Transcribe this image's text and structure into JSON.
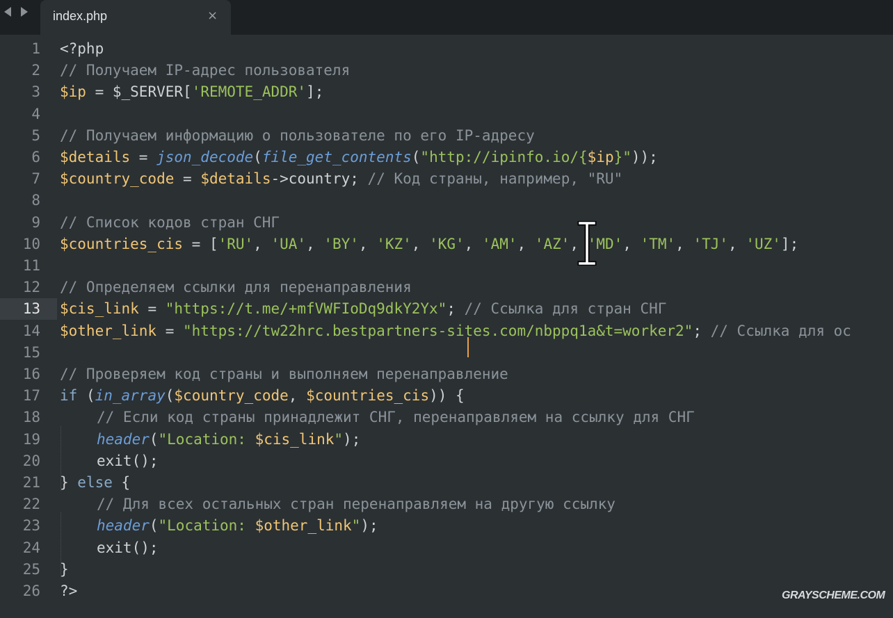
{
  "tab": {
    "title": "index.php",
    "close_glyph": "×"
  },
  "editor": {
    "active_line": 13,
    "caret_color": "#e8a04a"
  },
  "watermark": "GRAYSCHEME.COM",
  "lines": [
    {
      "num": "1",
      "tokens": [
        {
          "t": "p",
          "v": "<?php"
        }
      ]
    },
    {
      "num": "2",
      "tokens": [
        {
          "t": "c",
          "v": "// Получаем IP-адрес пользователя"
        }
      ]
    },
    {
      "num": "3",
      "tokens": [
        {
          "t": "v",
          "v": "$ip"
        },
        {
          "t": "p",
          "v": " = "
        },
        {
          "t": "sv",
          "v": "$_SERVER"
        },
        {
          "t": "p",
          "v": "["
        },
        {
          "t": "s",
          "v": "'REMOTE_ADDR'"
        },
        {
          "t": "p",
          "v": "];"
        }
      ]
    },
    {
      "num": "4",
      "tokens": []
    },
    {
      "num": "5",
      "tokens": [
        {
          "t": "c",
          "v": "// Получаем информацию о пользователе по его IP-адресу"
        }
      ]
    },
    {
      "num": "6",
      "tokens": [
        {
          "t": "v",
          "v": "$details"
        },
        {
          "t": "p",
          "v": " = "
        },
        {
          "t": "f",
          "v": "json_decode"
        },
        {
          "t": "p",
          "v": "("
        },
        {
          "t": "f",
          "v": "file_get_contents"
        },
        {
          "t": "p",
          "v": "("
        },
        {
          "t": "s",
          "v": "\"http://ipinfo.io/"
        },
        {
          "t": "s",
          "v": "{"
        },
        {
          "t": "v",
          "v": "$ip"
        },
        {
          "t": "s",
          "v": "}\""
        },
        {
          "t": "p",
          "v": "));"
        }
      ]
    },
    {
      "num": "7",
      "tokens": [
        {
          "t": "v",
          "v": "$country_code"
        },
        {
          "t": "p",
          "v": " = "
        },
        {
          "t": "v",
          "v": "$details"
        },
        {
          "t": "p",
          "v": "->country; "
        },
        {
          "t": "c",
          "v": "// Код страны, например, \"RU\""
        }
      ]
    },
    {
      "num": "8",
      "tokens": []
    },
    {
      "num": "9",
      "tokens": [
        {
          "t": "c",
          "v": "// Список кодов стран СНГ"
        }
      ]
    },
    {
      "num": "10",
      "tokens": [
        {
          "t": "v",
          "v": "$countries_cis"
        },
        {
          "t": "p",
          "v": " = ["
        },
        {
          "t": "s",
          "v": "'RU'"
        },
        {
          "t": "p",
          "v": ", "
        },
        {
          "t": "s",
          "v": "'UA'"
        },
        {
          "t": "p",
          "v": ", "
        },
        {
          "t": "s",
          "v": "'BY'"
        },
        {
          "t": "p",
          "v": ", "
        },
        {
          "t": "s",
          "v": "'KZ'"
        },
        {
          "t": "p",
          "v": ", "
        },
        {
          "t": "s",
          "v": "'KG'"
        },
        {
          "t": "p",
          "v": ", "
        },
        {
          "t": "s",
          "v": "'AM'"
        },
        {
          "t": "p",
          "v": ", "
        },
        {
          "t": "s",
          "v": "'AZ'"
        },
        {
          "t": "p",
          "v": ", "
        },
        {
          "t": "s",
          "v": "'MD'"
        },
        {
          "t": "p",
          "v": ", "
        },
        {
          "t": "s",
          "v": "'TM'"
        },
        {
          "t": "p",
          "v": ", "
        },
        {
          "t": "s",
          "v": "'TJ'"
        },
        {
          "t": "p",
          "v": ", "
        },
        {
          "t": "s",
          "v": "'UZ'"
        },
        {
          "t": "p",
          "v": "];"
        }
      ]
    },
    {
      "num": "11",
      "tokens": []
    },
    {
      "num": "12",
      "tokens": [
        {
          "t": "c",
          "v": "// Определяем ссылки для перенаправления"
        }
      ]
    },
    {
      "num": "13",
      "tokens": [
        {
          "t": "v",
          "v": "$cis_link"
        },
        {
          "t": "p",
          "v": " = "
        },
        {
          "t": "s",
          "v": "\"https://t.me/+mfVWFIoDq9dkY2Yx\""
        },
        {
          "t": "p",
          "v": "; "
        },
        {
          "t": "c",
          "v": "// Ссылка для стран СНГ"
        }
      ]
    },
    {
      "num": "14",
      "tokens": [
        {
          "t": "v",
          "v": "$other_link"
        },
        {
          "t": "p",
          "v": " = "
        },
        {
          "t": "s",
          "v": "\"https://tw22hrc.bestpartners-sites.com/nbppq1a&t=worker2\""
        },
        {
          "t": "p",
          "v": "; "
        },
        {
          "t": "c",
          "v": "// Ссылка для ос"
        }
      ]
    },
    {
      "num": "15",
      "tokens": []
    },
    {
      "num": "16",
      "tokens": [
        {
          "t": "c",
          "v": "// Проверяем код страны и выполняем перенаправление"
        }
      ]
    },
    {
      "num": "17",
      "tokens": [
        {
          "t": "k",
          "v": "if"
        },
        {
          "t": "p",
          "v": " ("
        },
        {
          "t": "f",
          "v": "in_array"
        },
        {
          "t": "p",
          "v": "("
        },
        {
          "t": "v",
          "v": "$country_code"
        },
        {
          "t": "p",
          "v": ", "
        },
        {
          "t": "v",
          "v": "$countries_cis"
        },
        {
          "t": "p",
          "v": ")) {"
        }
      ]
    },
    {
      "num": "18",
      "indent": 1,
      "tokens": [
        {
          "t": "c",
          "v": "// Если код страны принадлежит СНГ, перенаправляем на ссылку для СНГ"
        }
      ]
    },
    {
      "num": "19",
      "indent": 1,
      "tokens": [
        {
          "t": "f",
          "v": "header"
        },
        {
          "t": "p",
          "v": "("
        },
        {
          "t": "s",
          "v": "\"Location: "
        },
        {
          "t": "v",
          "v": "$cis_link"
        },
        {
          "t": "s",
          "v": "\""
        },
        {
          "t": "p",
          "v": ");"
        }
      ]
    },
    {
      "num": "20",
      "indent": 1,
      "tokens": [
        {
          "t": "fn",
          "v": "exit"
        },
        {
          "t": "p",
          "v": "();"
        }
      ]
    },
    {
      "num": "21",
      "tokens": [
        {
          "t": "p",
          "v": "} "
        },
        {
          "t": "k",
          "v": "else"
        },
        {
          "t": "p",
          "v": " {"
        }
      ]
    },
    {
      "num": "22",
      "indent": 1,
      "tokens": [
        {
          "t": "c",
          "v": "// Для всех остальных стран перенаправляем на другую ссылку"
        }
      ]
    },
    {
      "num": "23",
      "indent": 1,
      "tokens": [
        {
          "t": "f",
          "v": "header"
        },
        {
          "t": "p",
          "v": "("
        },
        {
          "t": "s",
          "v": "\"Location: "
        },
        {
          "t": "v",
          "v": "$other_link"
        },
        {
          "t": "s",
          "v": "\""
        },
        {
          "t": "p",
          "v": ");"
        }
      ]
    },
    {
      "num": "24",
      "indent": 1,
      "tokens": [
        {
          "t": "fn",
          "v": "exit"
        },
        {
          "t": "p",
          "v": "();"
        }
      ]
    },
    {
      "num": "25",
      "tokens": [
        {
          "t": "p",
          "v": "}"
        }
      ]
    },
    {
      "num": "26",
      "tokens": [
        {
          "t": "p",
          "v": "?>"
        }
      ]
    }
  ]
}
